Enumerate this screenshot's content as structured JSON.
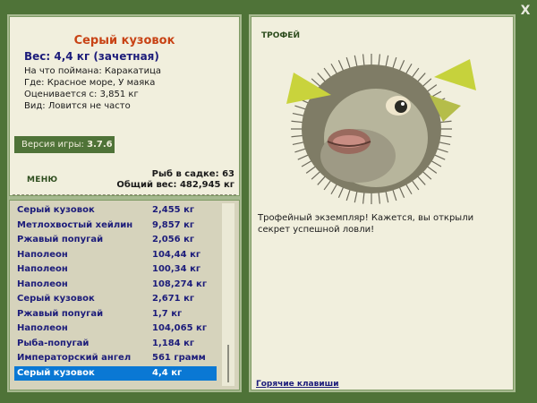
{
  "fish": {
    "name": "Серый кузовок",
    "weight": "Вес: 4,4 кг (зачетная)",
    "bait": "На что поймана: Каракатица",
    "place": "Где: Красное море, У маяка",
    "valued": "Оценивается с: 3,851 кг",
    "kind": "Вид: Ловится не часто"
  },
  "version": {
    "label": "Версия игры:",
    "value": "3.7.6"
  },
  "menu_label": "МЕНЮ",
  "stats": {
    "in_cage": "Рыб в садке: 63",
    "total_weight": "Общий вес: 482,945 кг"
  },
  "catch_list": [
    {
      "name": "Серый кузовок",
      "weight": "2,455 кг"
    },
    {
      "name": "Метлохвостый хейлин",
      "weight": "9,857 кг"
    },
    {
      "name": "Ржавый попугай",
      "weight": "2,056 кг"
    },
    {
      "name": "Наполеон",
      "weight": "104,44 кг"
    },
    {
      "name": "Наполеон",
      "weight": "100,34 кг"
    },
    {
      "name": "Наполеон",
      "weight": "108,274 кг"
    },
    {
      "name": "Серый кузовок",
      "weight": "2,671 кг"
    },
    {
      "name": "Ржавый попугай",
      "weight": "1,7 кг"
    },
    {
      "name": "Наполеон",
      "weight": "104,065 кг"
    },
    {
      "name": "Рыба-попугай",
      "weight": "1,184 кг"
    },
    {
      "name": "Императорский ангел",
      "weight": "561 грамм"
    },
    {
      "name": "Серый кузовок",
      "weight": "4,4 кг",
      "selected": true
    }
  ],
  "trophy": {
    "title": "ТРОФЕЙ",
    "text": "Трофейный экземпляр! Кажется, вы открыли секрет успешной ловли!"
  },
  "hotkeys_label": "Горячие клавиши",
  "close_label": "X",
  "colors": {
    "background": "#4f7338",
    "panel": "#f1efdd",
    "list_bg": "#d6d3bc",
    "fish_name": "#c84315",
    "list_text": "#1c1c7a",
    "selected": "#0a78d4"
  }
}
